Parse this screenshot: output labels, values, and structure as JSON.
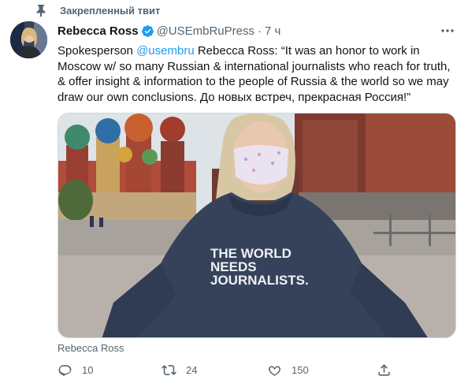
{
  "pinned": {
    "label": "Закрепленный твит",
    "icon": "pin-icon"
  },
  "author": {
    "display_name": "Rebecca Ross",
    "verified": true,
    "handle": "@USEmbRuPress",
    "separator": "·",
    "time": "7 ч"
  },
  "tweet": {
    "text_prefix": "Spokesperson ",
    "mention": "@usembru",
    "text_suffix": " Rebecca Ross: “It was an honor to work in Moscow w/ so many Russian & international journalists who reach for truth, & offer insight & information to the people of Russia & the world so we may draw our own conclusions. До новых встреч, прекрасная Россия!”"
  },
  "media": {
    "hoodie_text_line1": "THE WORLD",
    "hoodie_text_line2": "NEEDS",
    "hoodie_text_line3": "JOURNALISTS.",
    "credit": "Rebecca Ross"
  },
  "actions": {
    "reply": {
      "icon": "reply-icon",
      "count": "10"
    },
    "retweet": {
      "icon": "retweet-icon",
      "count": "24"
    },
    "like": {
      "icon": "heart-icon",
      "count": "150"
    },
    "share": {
      "icon": "share-icon"
    }
  },
  "colors": {
    "accent": "#1d9bf0",
    "muted": "#536471",
    "text": "#0f1419"
  }
}
